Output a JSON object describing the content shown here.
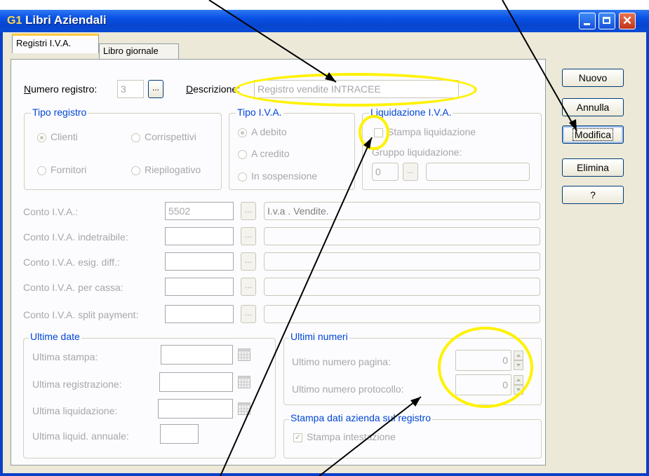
{
  "window": {
    "title": "Libri Aziendali",
    "app_icon_text": "G1"
  },
  "tabs": [
    {
      "label": "Registri I.V.A.",
      "active": true
    },
    {
      "label": "Libro giornale",
      "active": false
    }
  ],
  "registro": {
    "numero_label_u": "N",
    "numero_label_rest": "umero registro:",
    "numero_value": "3",
    "descrizione_label_u": "D",
    "descrizione_label_rest": "escrizione:",
    "descrizione_value": "Registro vendite INTRACEE"
  },
  "tipo_registro": {
    "title": "Tipo registro",
    "options": [
      "Clienti",
      "Corrispettivi",
      "Fornitori",
      "Riepilogativo"
    ],
    "selected": "Clienti"
  },
  "tipo_iva": {
    "title": "Tipo I.V.A.",
    "options": [
      "A debito",
      "A credito",
      "In sospensione"
    ],
    "selected": "A debito"
  },
  "liquidazione": {
    "title": "Liquidazione I.V.A.",
    "stampa_label": "Stampa liquidazione",
    "stampa_checked": false,
    "gruppo_label": "Gruppo liquidazione:",
    "gruppo_value": "0"
  },
  "conti": [
    {
      "label": "Conto I.V.A.:",
      "code": "5502",
      "desc": "I.v.a . Vendite."
    },
    {
      "label": "Conto I.V.A. indetraibile:",
      "code": "",
      "desc": ""
    },
    {
      "label": "Conto I.V.A. esig. diff.:",
      "code": "",
      "desc": ""
    },
    {
      "label": "Conto I.V.A. per cassa:",
      "code": "",
      "desc": ""
    },
    {
      "label": "Conto I.V.A. split payment:",
      "code": "",
      "desc": ""
    }
  ],
  "ultime_date": {
    "title": "Ultime date",
    "items": [
      "Ultima stampa:",
      "Ultima registrazione:",
      "Ultima liquidazione:",
      "Ultima liquid. annuale:"
    ]
  },
  "ultimi_numeri": {
    "title": "Ultimi numeri",
    "pagina_label": "Ultimo numero pagina:",
    "pagina_value": "0",
    "protocollo_label": "Ultimo numero protocollo:",
    "protocollo_value": "0"
  },
  "stampa_dati": {
    "title": "Stampa dati azienda sul registro",
    "intestazione_label": "Stampa intestazione",
    "intestazione_checked": true
  },
  "buttons": {
    "nuovo": "Nuovo",
    "annulla": "Annulla",
    "modifica": "Modifica",
    "elimina": "Elimina",
    "help": "?"
  },
  "colors": {
    "titlebar": "#0a52e6",
    "annotation": "#fff200",
    "disabled_text": "#a7a6aa",
    "group_title": "#0046d5"
  }
}
